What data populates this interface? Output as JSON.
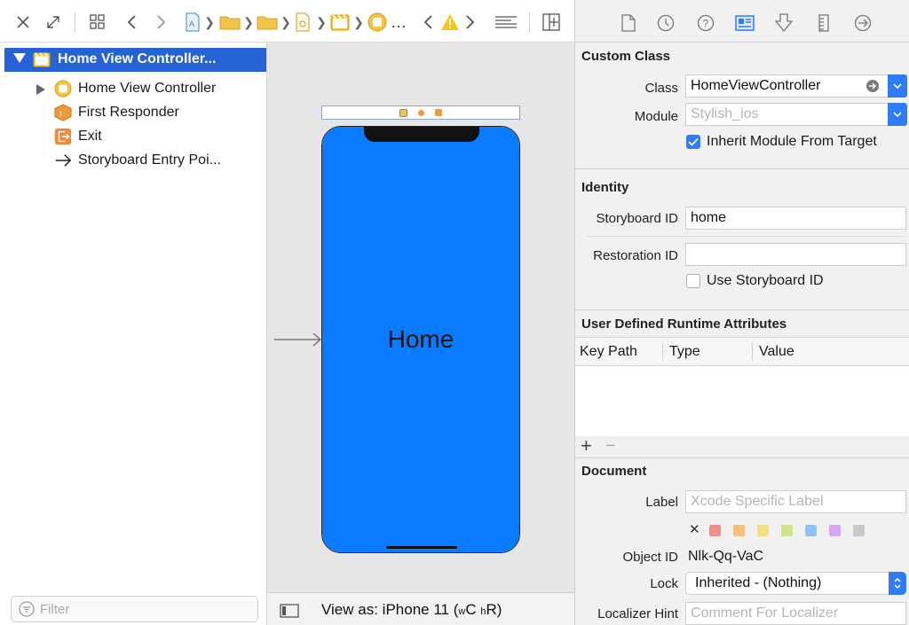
{
  "toolbar": {
    "breadcrumb_more": "…"
  },
  "navigator": {
    "items": [
      {
        "label": "Home View Controller...",
        "icon": "scene-icon",
        "selected": true
      },
      {
        "label": "Home View Controller",
        "icon": "view-controller-icon"
      },
      {
        "label": "First Responder",
        "icon": "first-responder-icon"
      },
      {
        "label": "Exit",
        "icon": "exit-icon"
      },
      {
        "label": "Storyboard Entry Poi...",
        "icon": "arrow-right-icon"
      }
    ],
    "filter_placeholder": "Filter"
  },
  "canvas": {
    "screen_label": "Home",
    "screen_color": "#0a7bff",
    "view_as_prefix": "View as: iPhone 11 (",
    "size_w": "w",
    "size_c": "C",
    "size_h": "h",
    "size_r": "R)"
  },
  "inspector": {
    "custom_class": {
      "title": "Custom Class",
      "class_label": "Class",
      "class_value": "HomeViewController",
      "module_label": "Module",
      "module_placeholder": "Stylish_ios",
      "inherit_label": "Inherit Module From Target",
      "inherit_checked": true
    },
    "identity": {
      "title": "Identity",
      "storyboard_id_label": "Storyboard ID",
      "storyboard_id_value": "home",
      "restoration_id_label": "Restoration ID",
      "restoration_id_value": "",
      "use_storyboard_id_label": "Use Storyboard ID",
      "use_storyboard_id_checked": false
    },
    "runtime_attributes": {
      "title": "User Defined Runtime Attributes",
      "columns": [
        "Key Path",
        "Type",
        "Value"
      ],
      "add": "+",
      "remove": "−"
    },
    "document": {
      "title": "Document",
      "label_label": "Label",
      "label_placeholder": "Xcode Specific Label",
      "clear_color": "✕",
      "colors": [
        "#ee8f8a",
        "#f2c27e",
        "#f4e07e",
        "#cfe38a",
        "#8fc2f3",
        "#d3aaf0",
        "#c9c9c9"
      ],
      "object_id_label": "Object ID",
      "object_id_value": "Nlk-Qq-VaC",
      "lock_label": "Lock",
      "lock_value": "Inherited - (Nothing)",
      "localizer_hint_label": "Localizer Hint",
      "localizer_hint_placeholder": "Comment For Localizer"
    }
  },
  "colors": {
    "selection": "#2462d5",
    "accent": "#2f7cf6"
  }
}
